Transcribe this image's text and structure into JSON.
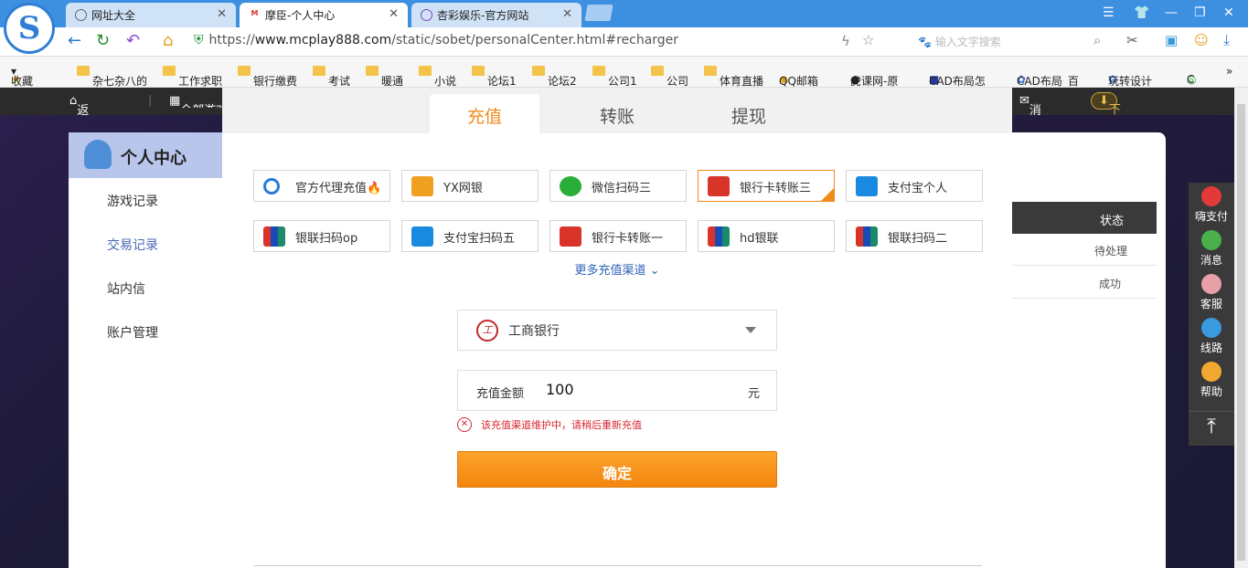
{
  "browser": {
    "tabs": [
      {
        "label": "网址大全"
      },
      {
        "label": "摩臣-个人中心"
      },
      {
        "label": "杏彩娱乐-官方网站"
      }
    ],
    "url_scheme": "https://",
    "url_host": "www.mcplay888.com",
    "url_path": "/static/sobet/personalCenter.html#recharger",
    "search_placeholder": "输入文字搜索",
    "bookmarks": [
      "收藏",
      "杂七杂八的",
      "工作求职",
      "银行缴费",
      "考试",
      "暖通",
      "小说",
      "论坛1",
      "论坛2",
      "公司1",
      "公司",
      "体育直播",
      "QQ邮箱",
      "虎课网-原",
      "CAD布局怎",
      "CAD布局_百",
      "玩转设计_",
      "C"
    ]
  },
  "site_nav": {
    "home": "返回首页",
    "all_games": "全部游戏",
    "messages": "消息",
    "download": "下载中心"
  },
  "sidebar": {
    "title": "个人中心",
    "items": [
      "游戏记录",
      "交易记录",
      "站内信",
      "账户管理"
    ]
  },
  "right_panel": {
    "header_status": "状态",
    "rows": [
      "待处理",
      "成功"
    ]
  },
  "float_bar": [
    "嗨支付",
    "消息",
    "客服",
    "线路",
    "帮助"
  ],
  "modal": {
    "tabs": [
      "充值",
      "转账",
      "提现"
    ],
    "active_tab": "充值",
    "channels": [
      {
        "label": "官方代理充值",
        "selected": false
      },
      {
        "label": "YX网银",
        "selected": false
      },
      {
        "label": "微信扫码三",
        "selected": false
      },
      {
        "label": "银行卡转账三",
        "selected": true
      },
      {
        "label": "支付宝个人",
        "selected": false
      },
      {
        "label": "银联扫码op",
        "selected": false
      },
      {
        "label": "支付宝扫码五",
        "selected": false
      },
      {
        "label": "银行卡转账一",
        "selected": false
      },
      {
        "label": "hd银联",
        "selected": false
      },
      {
        "label": "银联扫码二",
        "selected": false
      }
    ],
    "more_channels": "更多充值渠道",
    "bank": "工商银行",
    "amount_label": "充值金额",
    "amount_value": "100",
    "amount_unit": "元",
    "error": "该充值渠道维护中，请稍后重新充值",
    "submit": "确定"
  },
  "colors": {
    "accent": "#f08a1b",
    "error": "#d9272e",
    "link": "#2e64b4"
  }
}
